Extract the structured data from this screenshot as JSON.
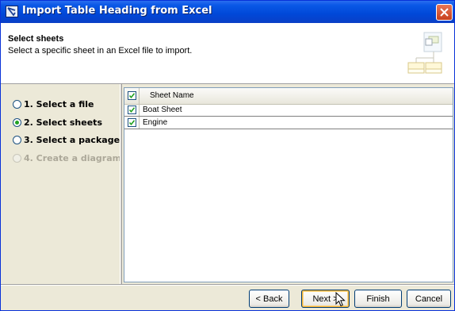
{
  "window": {
    "title": "Import Table Heading from Excel"
  },
  "header": {
    "title": "Select sheets",
    "description": "Select a specific sheet in an Excel file to import."
  },
  "steps": [
    {
      "label": "1. Select a file",
      "state": "normal"
    },
    {
      "label": "2. Select sheets",
      "state": "selected"
    },
    {
      "label": "3. Select a package",
      "state": "normal"
    },
    {
      "label": "4. Create a diagram",
      "state": "disabled"
    }
  ],
  "table": {
    "header": {
      "checked": true,
      "column_name": "Sheet Name"
    },
    "rows": [
      {
        "checked": true,
        "name": "Boat Sheet"
      },
      {
        "checked": true,
        "name": "Engine"
      }
    ]
  },
  "buttons": {
    "back": "< Back",
    "next": "Next >",
    "finish": "Finish",
    "cancel": "Cancel"
  },
  "colors": {
    "titlebar": "#0a58e6",
    "selected_radio": "#21a121",
    "disabled_text": "#aca899",
    "check_mark": "#21a121"
  },
  "icons": {
    "title": "window-app-icon",
    "close": "close-x-icon",
    "header": "package-diagram-icon",
    "cursor": "mouse-pointer-icon"
  }
}
